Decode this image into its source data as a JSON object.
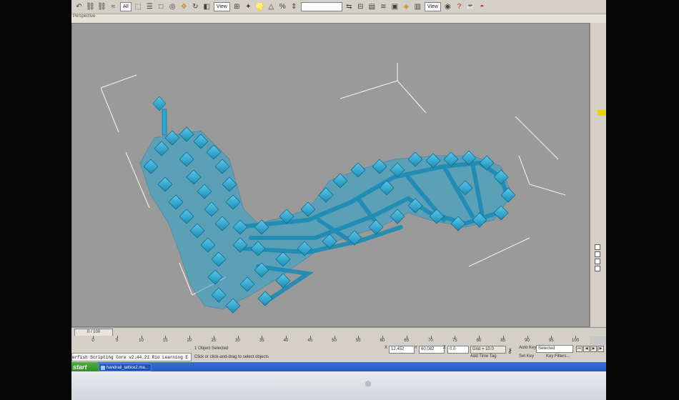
{
  "toolbar": {
    "filter_value": "All",
    "view_value": "View",
    "view_value_2": "View"
  },
  "viewport": {
    "label": "Perspective"
  },
  "timeline": {
    "frame_display": "0 / 100",
    "ticks": [
      "0",
      "5",
      "10",
      "15",
      "20",
      "25",
      "30",
      "35",
      "40",
      "45",
      "50",
      "55",
      "60",
      "65",
      "70",
      "75",
      "80",
      "85",
      "90",
      "95",
      "100"
    ]
  },
  "status": {
    "script_listener": "erfish Scripting Core v2.44.21 Rio Learning E",
    "selection": "1 Object Selected",
    "prompt": "Click or click-and-drag to select objects",
    "x_value": "12.452",
    "y_value": "60.082",
    "z_value": "0.0",
    "grid": "Grid = 10.0",
    "add_time_tag": "Add Time Tag",
    "auto_key": "Auto Key",
    "selected_filter": "Selected",
    "set_key": "Set Key",
    "key_filters": "Key Filters..."
  },
  "taskbar": {
    "start_label": "start",
    "task_label": "handrail_lattice2.ma..."
  },
  "colors": {
    "lattice": "#2aa6cf",
    "viewport_bg": "#9a9a9a",
    "taskbar": "#2456c4",
    "start": "#3a9a2e"
  },
  "icons": {
    "monitor": "apple-logo",
    "start": "windows-flag-icon",
    "key": "key-icon"
  }
}
